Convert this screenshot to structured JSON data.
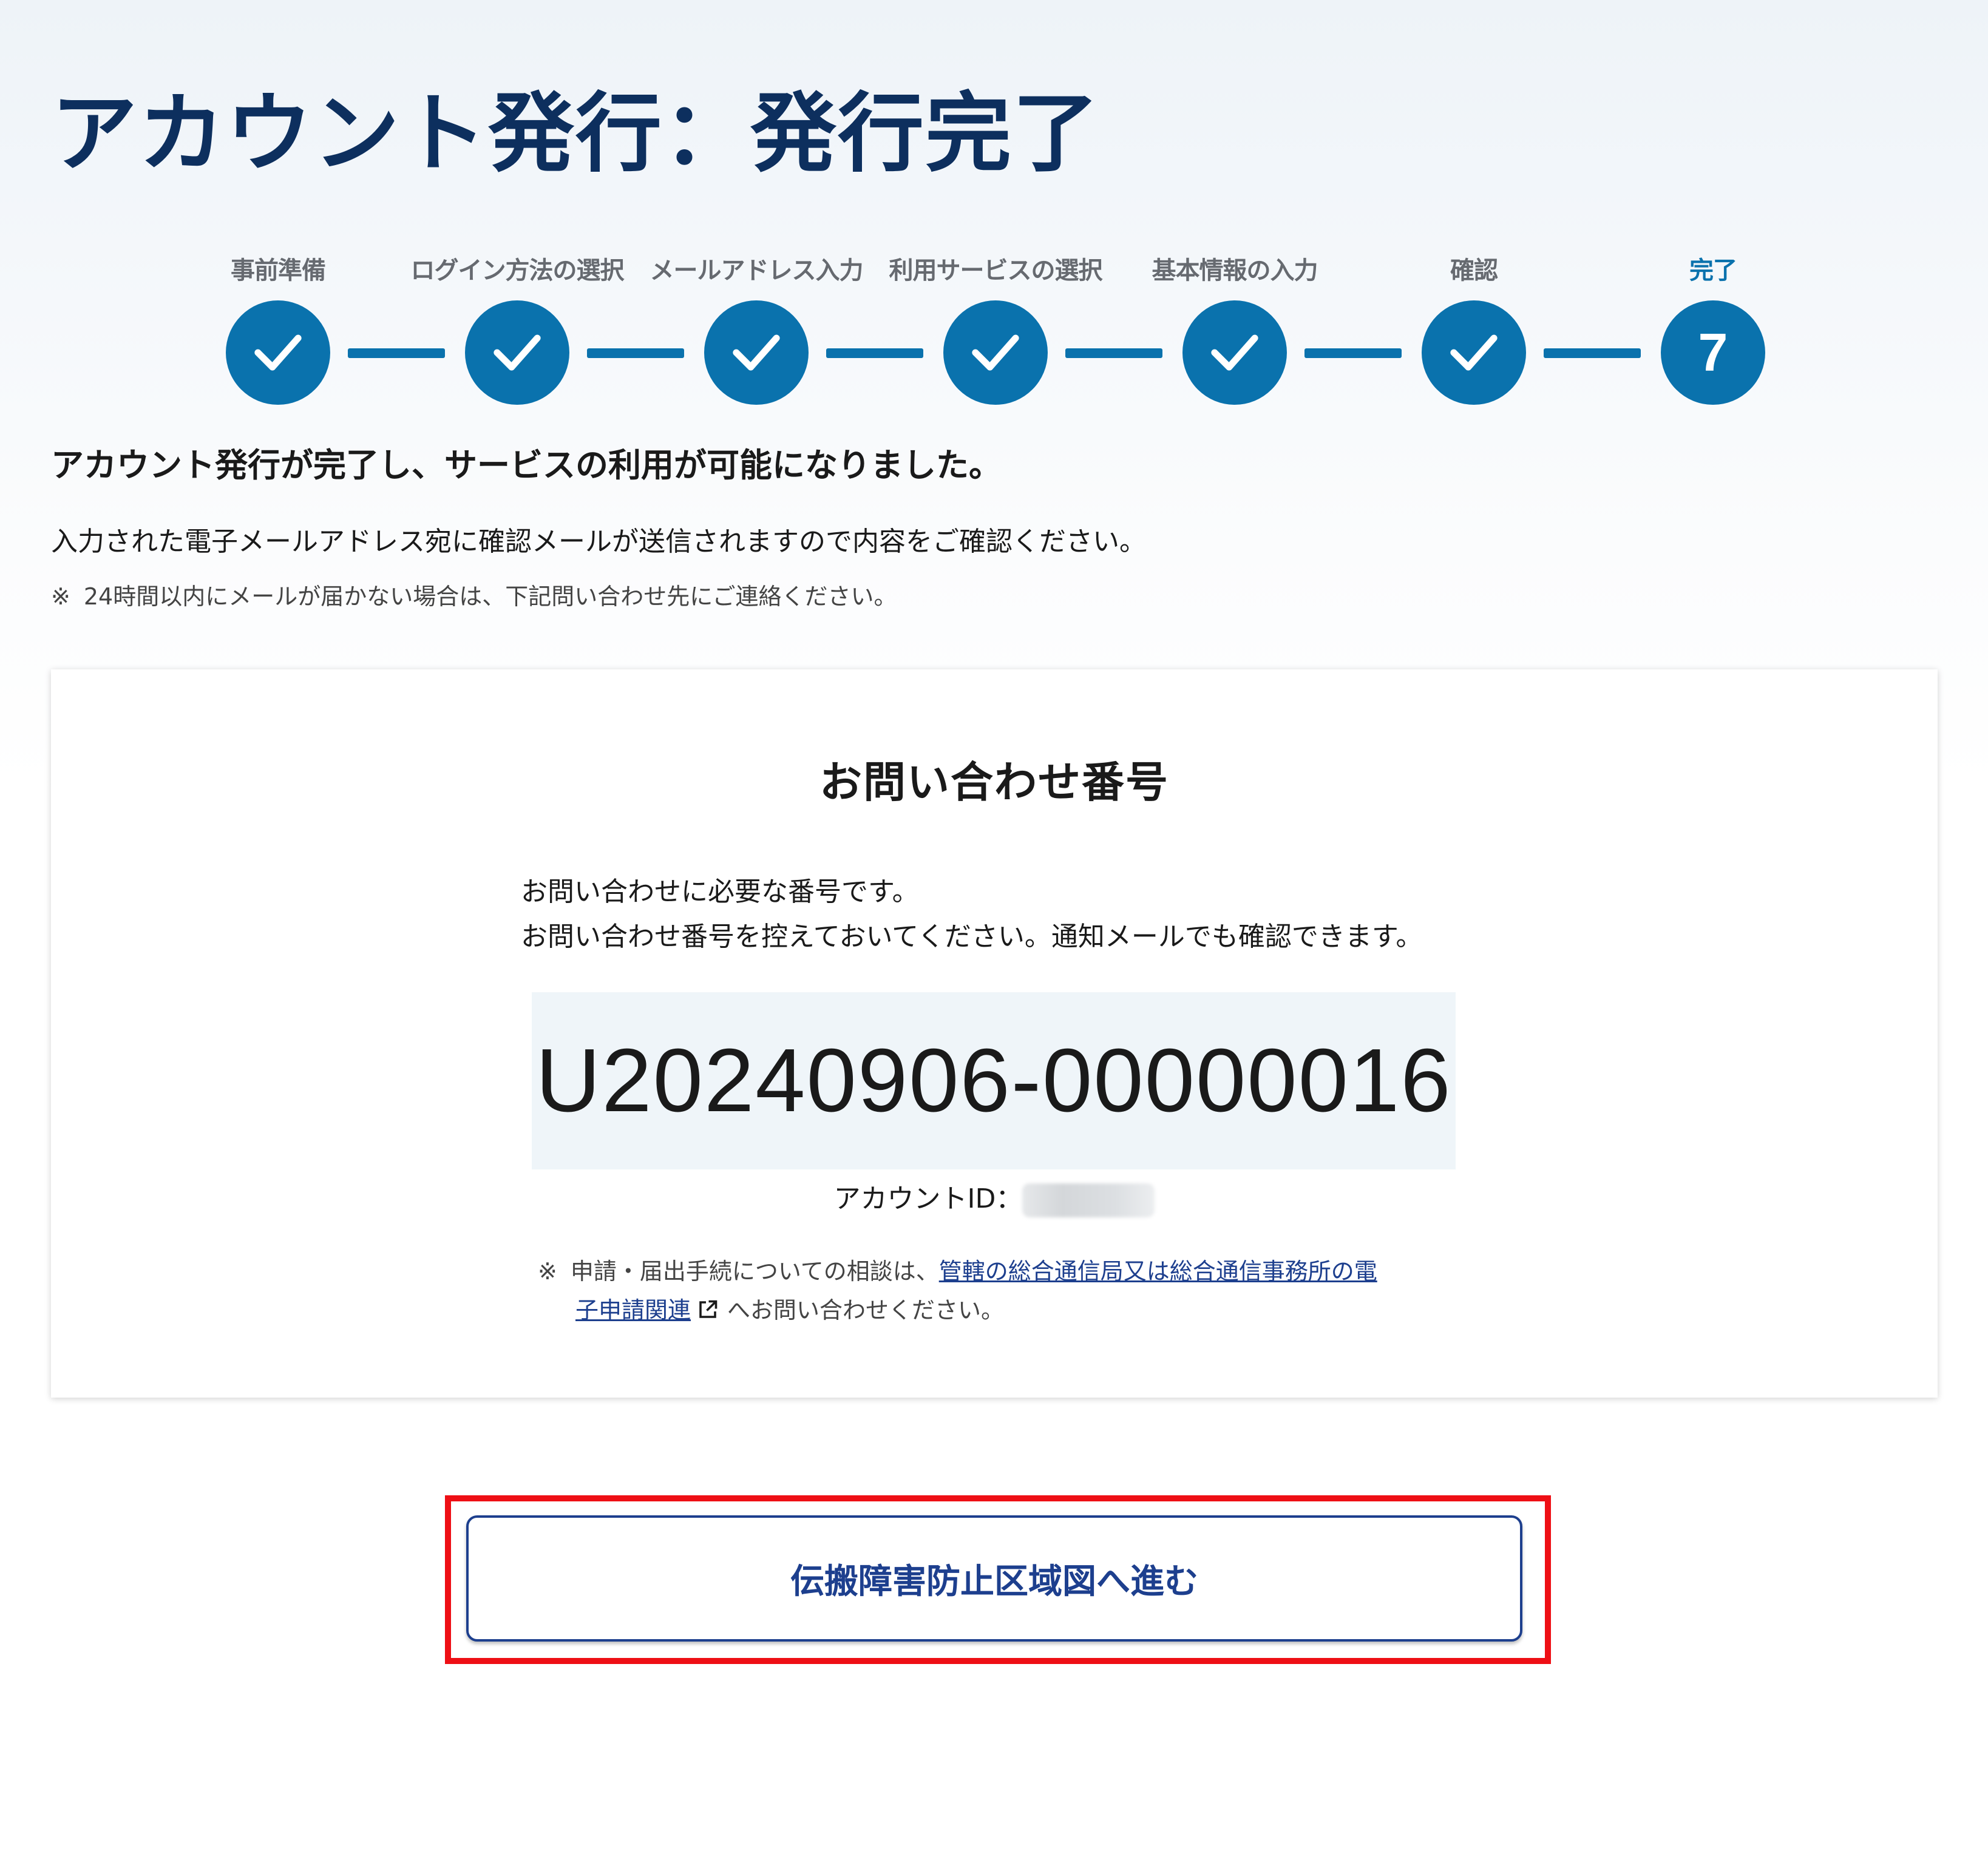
{
  "page": {
    "title": "アカウント発行：発行完了"
  },
  "steps": [
    {
      "label": "事前準備",
      "status": "done"
    },
    {
      "label": "ログイン方法の選択",
      "status": "done"
    },
    {
      "label": "メールアドレス入力",
      "status": "done"
    },
    {
      "label": "利用サービスの選択",
      "status": "done"
    },
    {
      "label": "基本情報の入力",
      "status": "done"
    },
    {
      "label": "確認",
      "status": "done"
    },
    {
      "label": "完了",
      "status": "current",
      "number": "7"
    }
  ],
  "message": {
    "lead": "アカウント発行が完了し、サービスの利用が可能になりました。",
    "body": "入力された電子メールアドレス宛に確認メールが送信されますので内容をご確認ください。",
    "note_mark": "※",
    "note": "24時間以内にメールが届かない場合は、下記問い合わせ先にご連絡ください。"
  },
  "inquiry_card": {
    "title": "お問い合わせ番号",
    "desc_line1": "お問い合わせに必要な番号です。",
    "desc_line2": "お問い合わせ番号を控えておいてください。通知メールでも確認できます。",
    "number": "U20240906-00000016",
    "account_id_label": "アカウントID：",
    "support_mark": "※",
    "support_prefix": "申請・届出手続についての相談は、",
    "support_link_part1": "管轄の総合通信局又は総合通信事務所の電",
    "support_link_part2": "子申請関連",
    "support_suffix": "へお問い合わせください。"
  },
  "actions": {
    "next_label": "伝搬障害防止区域図へ進む"
  },
  "colors": {
    "primary": "#0a72ad",
    "title": "#0d2f5e",
    "link": "#1d3f8e",
    "highlight": "#ee0f15",
    "number_box": "#eff5f9"
  },
  "icons": {
    "step_done": "checkmark-icon",
    "external_link": "external-link-icon"
  }
}
